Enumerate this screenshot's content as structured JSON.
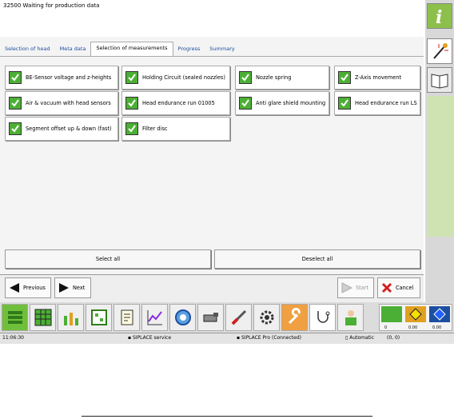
{
  "status_top": "32500 Waiting for production data",
  "tabs": [
    {
      "label": "Selection of head"
    },
    {
      "label": "Meta data"
    },
    {
      "label": "Selection of measurements",
      "active": true
    },
    {
      "label": "Progress"
    },
    {
      "label": "Summary"
    }
  ],
  "measurements": [
    {
      "label": "BE-Sensor voltage and z-heights",
      "checked": true
    },
    {
      "label": "Holding Circuit (sealed nozzles)",
      "checked": true
    },
    {
      "label": "Nozzle spring",
      "checked": true
    },
    {
      "label": "Z-Axis movement",
      "checked": true
    },
    {
      "label": "Air & vacuum with head sensors",
      "checked": true
    },
    {
      "label": "Head endurance run 01005",
      "checked": true
    },
    {
      "label": "Anti glare shield mounting",
      "checked": true
    },
    {
      "label": "Head endurance run LS",
      "checked": true
    },
    {
      "label": "Segment offset up & down (fast)",
      "checked": true
    },
    {
      "label": "Filter disc",
      "checked": true
    }
  ],
  "buttons": {
    "select_all": "Select all",
    "deselect_all": "Deselect all",
    "previous": "Previous",
    "next": "Next",
    "start": "Start",
    "cancel": "Cancel"
  },
  "status_bar": {
    "time": "11:06:30",
    "service": "SIPLACE service",
    "pro": "SIPLACE Pro (Connected)",
    "mode": "Automatic"
  },
  "gauges": {
    "value_left": "0",
    "value_mid": "0.00",
    "value_right": "0.00",
    "coords": "(0, 0)"
  },
  "colors": {
    "check_green": "#4caf35",
    "link_blue": "#1c4fa0",
    "cancel_red": "#d22020"
  }
}
